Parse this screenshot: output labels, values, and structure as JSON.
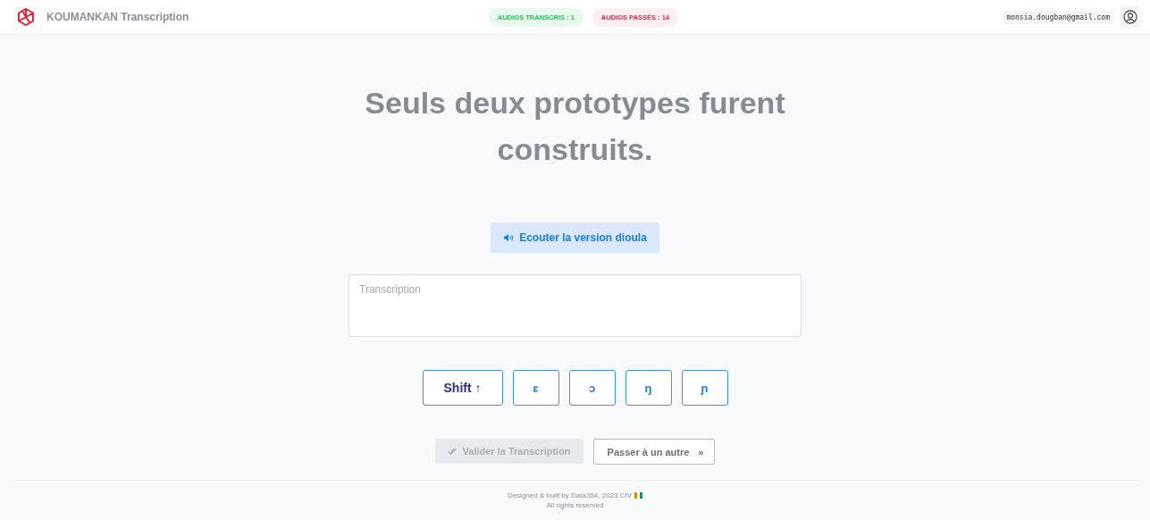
{
  "header": {
    "brand": "KOUMANKAN Transcription",
    "badges": [
      {
        "kind": "success",
        "label": "AUDIOS TRANSCRIS : 1"
      },
      {
        "kind": "danger",
        "label": "AUDIOS PASSÉS : 14"
      }
    ],
    "email": "monsia.dougban@gmail.com"
  },
  "sentence": "Seuls deux prototypes furent construits.",
  "listen_button": "Ecouter la version dioula",
  "transcription": {
    "placeholder": "Transcription"
  },
  "keys": [
    {
      "kind": "shift",
      "label": "Shift",
      "symbol": "↑"
    },
    {
      "kind": "char",
      "label": "ɛ"
    },
    {
      "kind": "char",
      "label": "ɔ"
    },
    {
      "kind": "char",
      "label": "ŋ"
    },
    {
      "kind": "char",
      "label": "ɲ"
    }
  ],
  "actions": {
    "validate": {
      "label": "Valider la Transcription",
      "disabled": true
    },
    "skip": {
      "label": "Passer à un autre",
      "symbol": "»"
    }
  },
  "footer": {
    "credit": "Designed & built by Data354, 2023 CIV",
    "rights": "All rights reserved"
  }
}
